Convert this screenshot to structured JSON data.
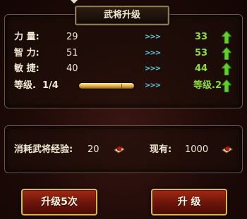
{
  "title": "武将升级",
  "stats": [
    {
      "label": "力 量:",
      "current": "29",
      "next": "33"
    },
    {
      "label": "智 力:",
      "current": "51",
      "next": "53"
    },
    {
      "label": "敏 捷:",
      "current": "40",
      "next": "44"
    }
  ],
  "level": {
    "label": "等级.",
    "current": "1/4",
    "next": "等级.2",
    "progress_fraction": 0.78
  },
  "arrow_glyph": ">>>",
  "cost": {
    "label": "消耗武将经验:",
    "amount": "20",
    "owned_label": "现有:",
    "owned": "1000"
  },
  "buttons": {
    "upgrade5": "升级5次",
    "upgrade": "升 级"
  },
  "colors": {
    "accent_green": "#8edb3a",
    "arrow_cyan": "#58d3e8",
    "button_red": "#8a1e0e",
    "gold_border": "#d7b35c"
  },
  "icons": {
    "stat_up": "green-up-arrow-icon",
    "exp_item": "exp-scroll-icon"
  }
}
